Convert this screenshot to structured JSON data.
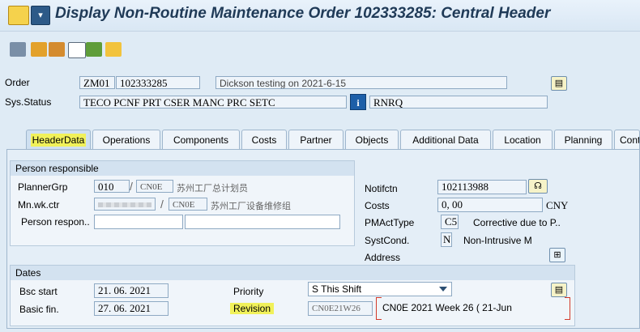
{
  "window": {
    "title": "Display Non-Routine Maintenance Order 102333285: Central Header"
  },
  "toolbar": {
    "icons": [
      "display-change-icon",
      "copy-icon",
      "navigate-icon",
      "list-icon",
      "edit-icon",
      "document-icon"
    ]
  },
  "header": {
    "order_label": "Order",
    "order_type": "ZM01",
    "order_number": "102333285",
    "order_desc": "Dickson testing on 2021-6-15",
    "status_label": "Sys.Status",
    "status_text": "TECO PCNF PRT  CSER MANC PRC  SETC",
    "status_info_icon": "i",
    "user_status": "RNRQ"
  },
  "tabs": [
    "HeaderData",
    "Operations",
    "Components",
    "Costs",
    "Partner",
    "Objects",
    "Additional Data",
    "Location",
    "Planning",
    "Cont"
  ],
  "person_responsible": {
    "heading": "Person responsible",
    "planner_grp_label": "PlannerGrp",
    "planner_grp_value": "010",
    "planner_grp_plant": "CN0E",
    "planner_grp_text": "苏州工厂总计划员",
    "mn_wk_ctr_label": "Mn.wk.ctr",
    "mn_wk_ctr_plant": "CN0E",
    "mn_wk_ctr_text": "苏州工厂设备维修组",
    "person_label": "Person respon.."
  },
  "right_panel": {
    "notifctn_label": "Notifctn",
    "notifctn_value": "102113988",
    "costs_label": "Costs",
    "costs_value": "0, 00",
    "currency": "CNY",
    "pmacttype_label": "PMActType",
    "pmacttype_value": "C5",
    "pmacttype_text": "Corrective due to P..",
    "systcond_label": "SystCond.",
    "systcond_value": "N",
    "systcond_text": "Non-Intrusive M",
    "address_label": "Address"
  },
  "dates": {
    "heading": "Dates",
    "bsc_start_label": "Bsc start",
    "bsc_start_value": "21. 06. 2021",
    "basic_fin_label": "Basic fin.",
    "basic_fin_value": "27. 06. 2021",
    "priority_label": "Priority",
    "priority_value": "S This Shift",
    "revision_label": "Revision",
    "revision_value": "CN0E21W26",
    "revision_text": "CN0E 2021 Week 26 ( 21-Jun"
  },
  "colors": {
    "highlight": "#f1f15a",
    "title": "#1f3a57",
    "accent": "#1d5fa8",
    "annotation": "#d23a2a"
  }
}
